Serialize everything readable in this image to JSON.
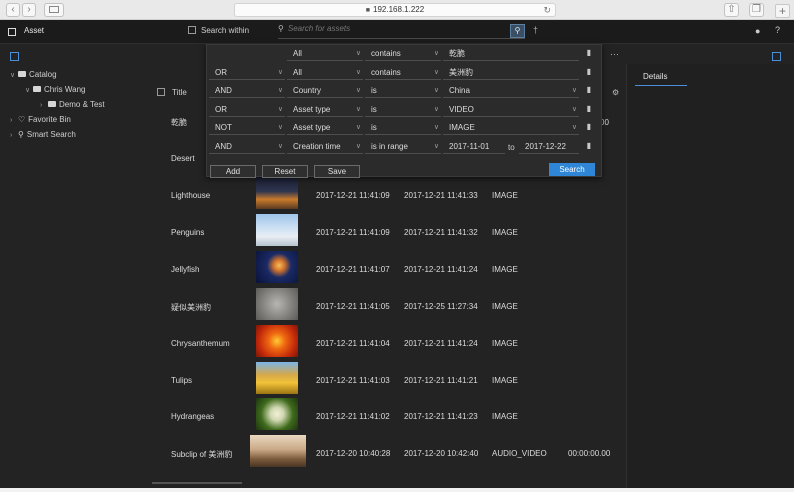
{
  "browser": {
    "url": "192.168.1.222",
    "back": "‹",
    "forward": "›",
    "new_tab": "+"
  },
  "app": {
    "title": "Asset",
    "search_within_label": "Search within",
    "search_placeholder": "Search for assets",
    "more": "···"
  },
  "tree": {
    "catalog": "Catalog",
    "chris": "Chris Wang",
    "demo": "Demo & Test",
    "favorite": "Favorite Bin",
    "smart": "Smart Search"
  },
  "table": {
    "title_header": "Title",
    "partial_row_label": "乾脆",
    "partial_row_time": "00",
    "desert": "Desert",
    "rows": [
      {
        "name": "Lighthouse",
        "c1": "2017-12-21 11:41:09",
        "c2": "2017-12-21 11:41:33",
        "type": "IMAGE",
        "duration": ""
      },
      {
        "name": "Penguins",
        "c1": "2017-12-21 11:41:09",
        "c2": "2017-12-21 11:41:32",
        "type": "IMAGE",
        "duration": ""
      },
      {
        "name": "Jellyfish",
        "c1": "2017-12-21 11:41:07",
        "c2": "2017-12-21 11:41:24",
        "type": "IMAGE",
        "duration": ""
      },
      {
        "name": "疑似美洲豹",
        "c1": "2017-12-21 11:41:05",
        "c2": "2017-12-25 11:27:34",
        "type": "IMAGE",
        "duration": ""
      },
      {
        "name": "Chrysanthemum",
        "c1": "2017-12-21 11:41:04",
        "c2": "2017-12-21 11:41:24",
        "type": "IMAGE",
        "duration": ""
      },
      {
        "name": "Tulips",
        "c1": "2017-12-21 11:41:03",
        "c2": "2017-12-21 11:41:21",
        "type": "IMAGE",
        "duration": ""
      },
      {
        "name": "Hydrangeas",
        "c1": "2017-12-21 11:41:02",
        "c2": "2017-12-21 11:41:23",
        "type": "IMAGE",
        "duration": ""
      },
      {
        "name": "Subclip of 美洲豹",
        "c1": "2017-12-20 10:40:28",
        "c2": "2017-12-20 10:42:40",
        "type": "AUDIO_VIDEO",
        "duration": "00:00:00.00"
      }
    ]
  },
  "right_panel": {
    "details_tab": "Details"
  },
  "advanced_search": {
    "conditions": [
      {
        "logic": "",
        "field": "All",
        "op": "contains",
        "value": "乾脆"
      },
      {
        "logic": "OR",
        "field": "All",
        "op": "contains",
        "value": "美洲豹"
      },
      {
        "logic": "AND",
        "field": "Country",
        "op": "is",
        "value": "China"
      },
      {
        "logic": "OR",
        "field": "Asset type",
        "op": "is",
        "value": "VIDEO"
      },
      {
        "logic": "NOT",
        "field": "Asset type",
        "op": "is",
        "value": "IMAGE"
      },
      {
        "logic": "AND",
        "field": "Creation time",
        "op": "is in range",
        "value": "2017-11-01",
        "value_to": "2017-12-22"
      }
    ],
    "to_label": "to",
    "add_label": "Add",
    "reset_label": "Reset",
    "save_label": "Save",
    "search_label": "Search"
  }
}
